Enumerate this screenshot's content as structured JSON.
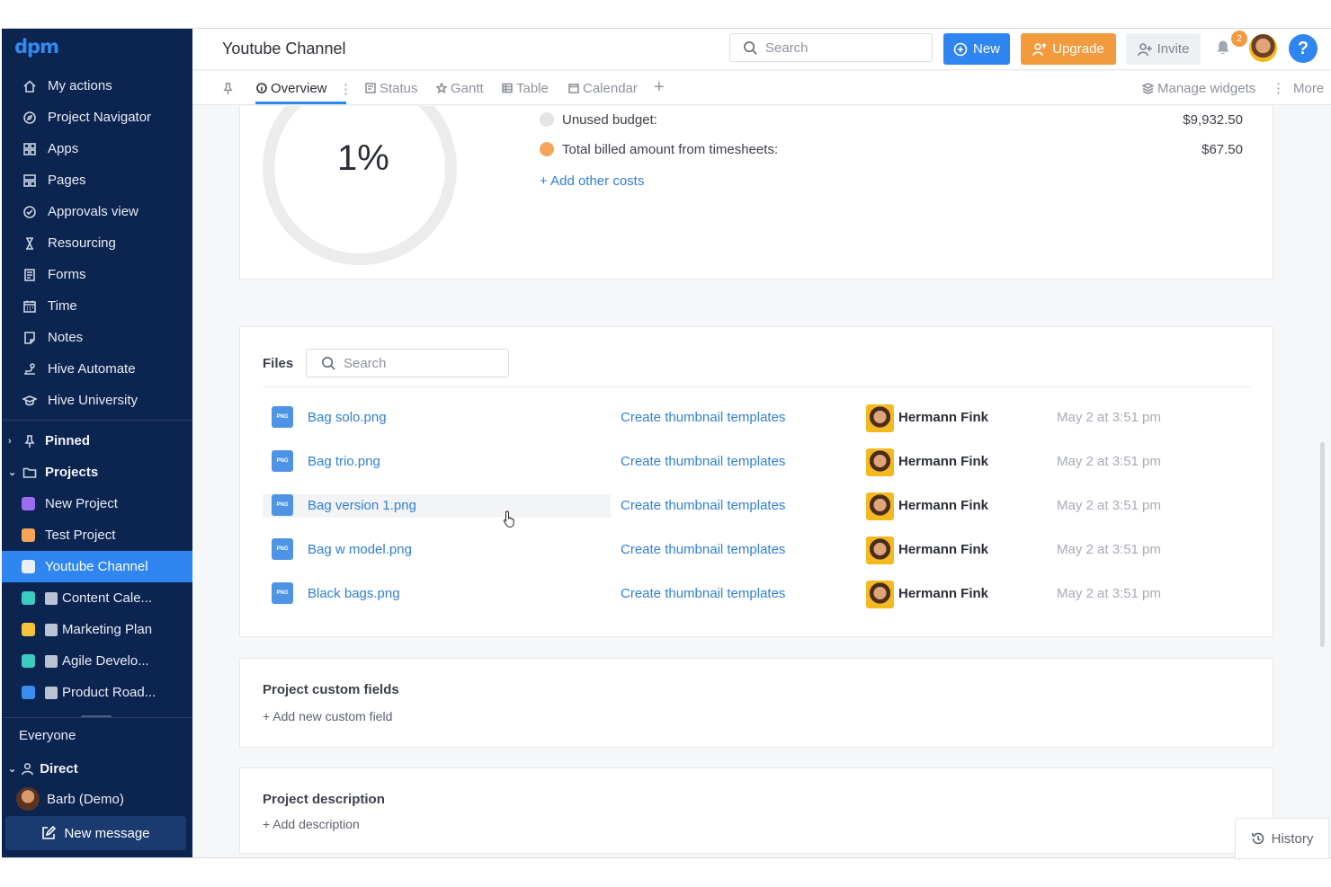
{
  "app": {
    "logo": "dpm",
    "title": "Youtube Channel"
  },
  "sidebar": {
    "nav": [
      {
        "label": "My actions",
        "icon": "home-icon"
      },
      {
        "label": "Project Navigator",
        "icon": "compass-icon"
      },
      {
        "label": "Apps",
        "icon": "apps-grid-icon"
      },
      {
        "label": "Pages",
        "icon": "pages-icon"
      },
      {
        "label": "Approvals view",
        "icon": "approval-check-icon"
      },
      {
        "label": "Resourcing",
        "icon": "hourglass-icon"
      },
      {
        "label": "Forms",
        "icon": "forms-icon"
      },
      {
        "label": "Time",
        "icon": "calendar-icon"
      },
      {
        "label": "Notes",
        "icon": "note-icon"
      },
      {
        "label": "Hive Automate",
        "icon": "automate-icon"
      },
      {
        "label": "Hive University",
        "icon": "graduation-cap-icon"
      }
    ],
    "pinned_label": "Pinned",
    "projects_label": "Projects",
    "projects": [
      {
        "label": "New Project",
        "color": "#9b6cf0",
        "emoji": false
      },
      {
        "label": "Test Project",
        "color": "#f5a55a",
        "emoji": false
      },
      {
        "label": "Youtube Channel",
        "color": "#e9eefb",
        "emoji": false,
        "active": true
      },
      {
        "label": "Content Cale...",
        "color": "#3ccbc0",
        "emoji": true
      },
      {
        "label": "Marketing Plan",
        "color": "#f4c33b",
        "emoji": true
      },
      {
        "label": "Agile Develo...",
        "color": "#3ccbc0",
        "emoji": true
      },
      {
        "label": "Product Road...",
        "color": "#3a8ef0",
        "emoji": true
      }
    ],
    "everyone_label": "Everyone",
    "direct_label": "Direct",
    "direct_user": "Barb (Demo)",
    "new_message_label": "New message"
  },
  "header": {
    "search_placeholder": "Search",
    "new_label": "New",
    "upgrade_label": "Upgrade",
    "invite_label": "Invite",
    "notification_count": "2",
    "help_label": "?"
  },
  "tabs": {
    "items": [
      {
        "label": "Overview",
        "icon": "info-icon",
        "active": true
      },
      {
        "label": "Status",
        "icon": "status-icon"
      },
      {
        "label": "Gantt",
        "icon": "star-icon"
      },
      {
        "label": "Table",
        "icon": "table-icon"
      },
      {
        "label": "Calendar",
        "icon": "calendar-icon"
      }
    ],
    "add_label": "+",
    "manage_widgets_label": "Manage widgets",
    "more_label": "More"
  },
  "budget": {
    "percent": "1%",
    "rows": [
      {
        "label": "Unused budget:",
        "amount": "$9,932.50",
        "color": "#e5e5e5"
      },
      {
        "label": "Total billed amount from timesheets:",
        "amount": "$67.50",
        "color": "#f5a55a"
      }
    ],
    "add_costs_label": "+ Add other costs"
  },
  "files": {
    "label": "Files",
    "search_placeholder": "Search",
    "type_label": "PNG",
    "rows": [
      {
        "name": "Bag solo.png",
        "task": "Create thumbnail templates",
        "user": "Hermann Fink",
        "date": "May 2 at 3:51 pm"
      },
      {
        "name": "Bag trio.png",
        "task": "Create thumbnail templates",
        "user": "Hermann Fink",
        "date": "May 2 at 3:51 pm"
      },
      {
        "name": "Bag version 1.png",
        "task": "Create thumbnail templates",
        "user": "Hermann Fink",
        "date": "May 2 at 3:51 pm"
      },
      {
        "name": "Bag w model.png",
        "task": "Create thumbnail templates",
        "user": "Hermann Fink",
        "date": "May 2 at 3:51 pm"
      },
      {
        "name": "Black bags.png",
        "task": "Create thumbnail templates",
        "user": "Hermann Fink",
        "date": "May 2 at 3:51 pm"
      }
    ]
  },
  "custom_fields": {
    "title": "Project custom fields",
    "add_label": "+ Add new custom field"
  },
  "description": {
    "title": "Project description",
    "add_label": "+ Add description"
  },
  "history_label": "History"
}
